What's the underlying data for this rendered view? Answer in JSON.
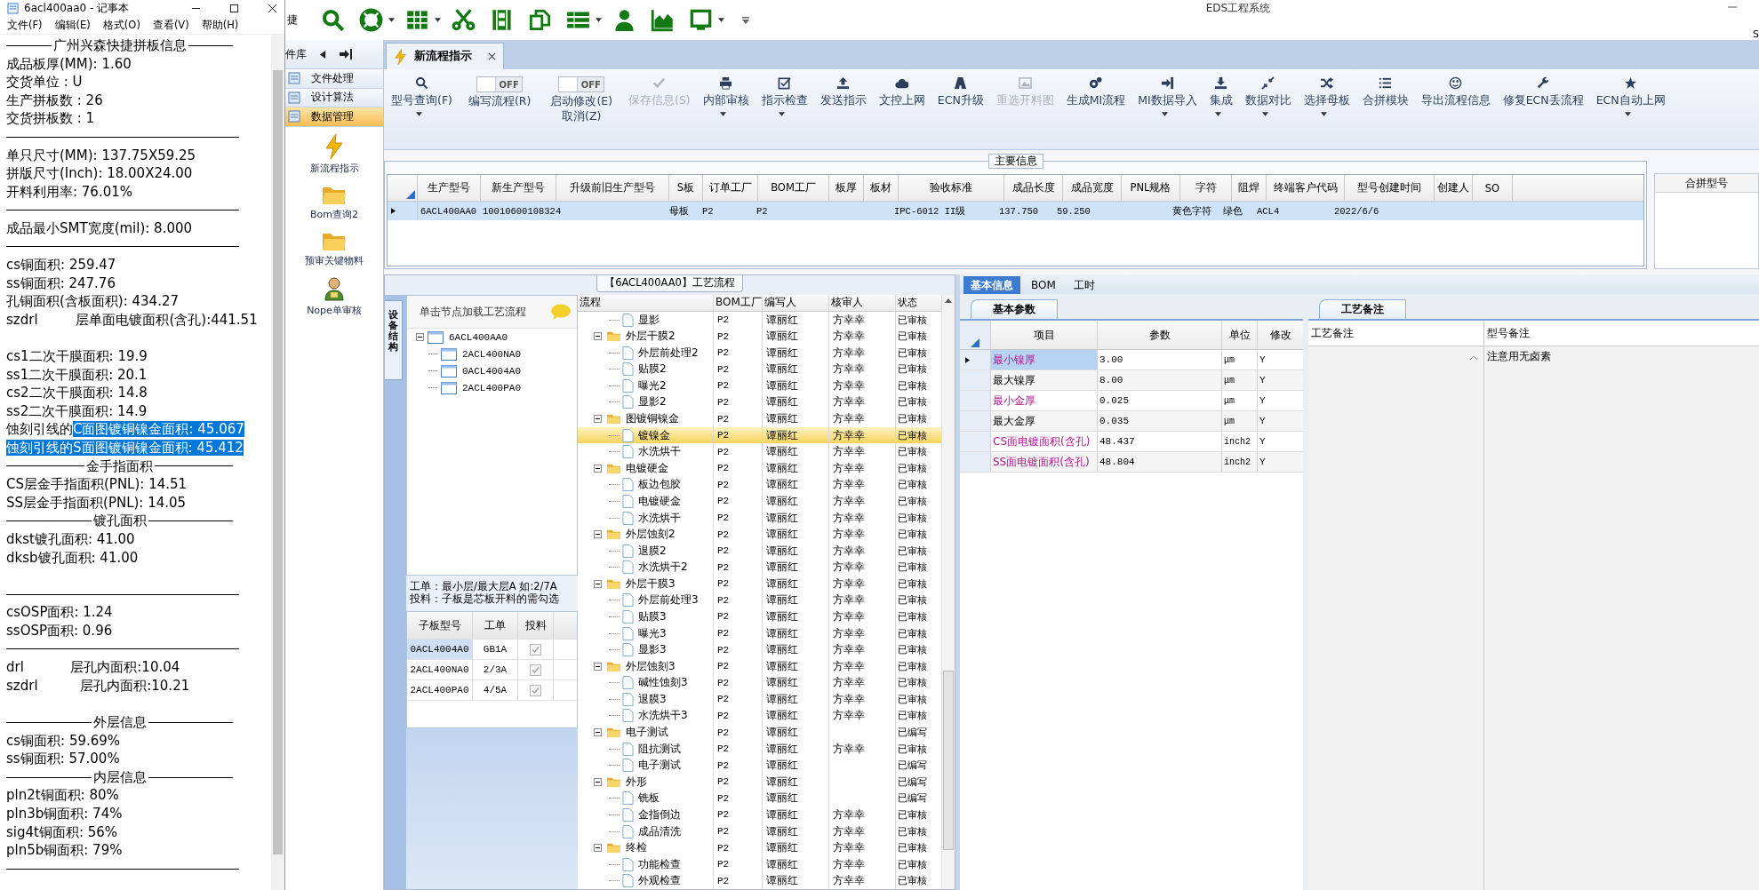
{
  "notepad": {
    "title": "6acl400aa0 - 记事本",
    "menu": [
      "文件(F)",
      "编辑(E)",
      "格式(O)",
      "查看(V)",
      "帮助(H)"
    ],
    "lines": [
      {
        "kind": "heading",
        "text": "广州兴森快捷拼板信息"
      },
      {
        "kind": "text",
        "text": "成品板厚(MM): 1.60"
      },
      {
        "kind": "text",
        "text": "交货单位 : U"
      },
      {
        "kind": "text",
        "text": "生产拼板数 : 26"
      },
      {
        "kind": "text",
        "text": "交货拼板数 : 1"
      },
      {
        "kind": "rule"
      },
      {
        "kind": "text",
        "text": "单只尺寸(MM): 137.75X59.25"
      },
      {
        "kind": "text",
        "text": "拼版尺寸(Inch): 18.00X24.00"
      },
      {
        "kind": "text",
        "text": "开料利用率: 76.01%"
      },
      {
        "kind": "rule"
      },
      {
        "kind": "text",
        "text": "成品最小SMT宽度(mil): 8.000"
      },
      {
        "kind": "rule"
      },
      {
        "kind": "text",
        "text": "cs铜面积: 259.47"
      },
      {
        "kind": "text",
        "text": "ss铜面积: 247.76"
      },
      {
        "kind": "text",
        "text": "孔铜面积(含板面积): 434.27"
      },
      {
        "kind": "text",
        "text": "szdrl         层单面电镀面积(含孔):441.51"
      },
      {
        "kind": "blank"
      },
      {
        "kind": "text",
        "text": "cs1二次干膜面积: 19.9"
      },
      {
        "kind": "text",
        "text": "ss1二次干膜面积: 20.1"
      },
      {
        "kind": "text",
        "text": "cs2二次干膜面积: 14.8"
      },
      {
        "kind": "text",
        "text": "ss2二次干膜面积: 14.9"
      },
      {
        "kind": "text",
        "text": "蚀刻引线的",
        "highlighted": "C面图镀铜镍金面积: 45.067"
      },
      {
        "kind": "text",
        "highlighted": "蚀刻引线的S面图镀铜镍金面积: 45.412"
      },
      {
        "kind": "heading",
        "text": "金手指面积"
      },
      {
        "kind": "text",
        "text": "CS层金手指面积(PNL): 14.51"
      },
      {
        "kind": "text",
        "text": "SS层金手指面积(PNL): 14.05"
      },
      {
        "kind": "heading",
        "text": "镀孔面积"
      },
      {
        "kind": "text",
        "text": "dkst镀孔面积: 41.00"
      },
      {
        "kind": "text",
        "text": "dksb镀孔面积: 41.00"
      },
      {
        "kind": "blank"
      },
      {
        "kind": "rule"
      },
      {
        "kind": "text",
        "text": "csOSP面积: 1.24"
      },
      {
        "kind": "text",
        "text": "ssOSP面积: 0.96"
      },
      {
        "kind": "rule"
      },
      {
        "kind": "text",
        "text": "drl           层孔内面积:10.04"
      },
      {
        "kind": "text",
        "text": "szdrl          层孔内面积:10.21"
      },
      {
        "kind": "blank"
      },
      {
        "kind": "heading",
        "text": "外层信息"
      },
      {
        "kind": "text",
        "text": "cs铜面积: 59.69%"
      },
      {
        "kind": "text",
        "text": "ss铜面积: 57.00%"
      },
      {
        "kind": "heading",
        "text": "内层信息"
      },
      {
        "kind": "text",
        "text": "pln2t铜面积: 80%"
      },
      {
        "kind": "text",
        "text": "pln3b铜面积: 74%"
      },
      {
        "kind": "text",
        "text": "sig4t铜面积: 56%"
      },
      {
        "kind": "text",
        "text": "pln5b铜面积: 79%"
      },
      {
        "kind": "rule"
      }
    ]
  },
  "app": {
    "title": "EDS工程系统",
    "quick_label": "捷",
    "edge_text": "S"
  },
  "components": {
    "title": "件库",
    "items": [
      {
        "label": "文件处理",
        "selected": false
      },
      {
        "label": "设计算法",
        "selected": false
      },
      {
        "label": "数据管理",
        "selected": true
      }
    ],
    "tools": [
      {
        "label": "新流程指示",
        "kind": "bolt"
      },
      {
        "label": "Bom查询2",
        "kind": "folder"
      },
      {
        "label": "预审关键物料",
        "kind": "folder"
      },
      {
        "label": "Nope单审核",
        "kind": "person"
      }
    ]
  },
  "doc_tab": {
    "label": "新流程指示",
    "selected": true
  },
  "ribbon": [
    {
      "kind": "button",
      "label": "型号查询(F)",
      "disabled": false,
      "dropdown": true
    },
    {
      "kind": "toggle",
      "label": "编写流程(R)",
      "switch_text": "OFF",
      "on": false
    },
    {
      "kind": "toggle",
      "label": "启动修改(E)",
      "label2": "取消(Z)",
      "switch_text": "OFF",
      "on": false
    },
    {
      "kind": "button",
      "label": "保存信息(S)",
      "disabled": true,
      "dropdown": false
    },
    {
      "kind": "button",
      "label": "内部审核",
      "disabled": false,
      "dropdown": true
    },
    {
      "kind": "button",
      "label": "指示检查",
      "disabled": false,
      "dropdown": true
    },
    {
      "kind": "button",
      "label": "发送指示",
      "disabled": false,
      "dropdown": false
    },
    {
      "kind": "button",
      "label": "文控上网",
      "disabled": false,
      "dropdown": false
    },
    {
      "kind": "button",
      "label": "ECN升级",
      "disabled": false,
      "dropdown": false
    },
    {
      "kind": "button",
      "label": "重选开料图",
      "disabled": true,
      "dropdown": false
    },
    {
      "kind": "button",
      "label": "生成MI流程",
      "disabled": false,
      "dropdown": false
    },
    {
      "kind": "button",
      "label": "MI数据导入",
      "disabled": false,
      "dropdown": true
    },
    {
      "kind": "button",
      "label": "集成",
      "disabled": false,
      "dropdown": true
    },
    {
      "kind": "button",
      "label": "数据对比",
      "disabled": false,
      "dropdown": true
    },
    {
      "kind": "button",
      "label": "选择母板",
      "disabled": false,
      "dropdown": true
    },
    {
      "kind": "button",
      "label": "合拼模块",
      "disabled": false,
      "dropdown": false
    },
    {
      "kind": "button",
      "label": "导出流程信息",
      "disabled": false,
      "dropdown": false
    },
    {
      "kind": "button",
      "label": "修复ECN丢流程",
      "disabled": false,
      "dropdown": false
    },
    {
      "kind": "button",
      "label": "ECN自动上网",
      "disabled": false,
      "dropdown": true
    }
  ],
  "main_info": {
    "title": "主要信息",
    "columns": [
      "生产型号",
      "新生产型号",
      "升级前旧生产型号",
      "S板",
      "订单工厂",
      "BOM工厂",
      "板厚",
      "板材",
      "验收标准",
      "成品长度",
      "成品宽度",
      "PNL规格",
      "字符",
      "阻焊",
      "终端客户代码",
      "型号创建时间",
      "创建人",
      "SO"
    ],
    "rows": [
      {
        "selected": true,
        "cells": [
          "6ACL400AA0",
          "10010600108324",
          null,
          "母板",
          "P2",
          "P2",
          null,
          null,
          "IPC-6012 II级",
          "137.750",
          "59.250",
          null,
          "黄色字符",
          "绿色",
          "ACL4",
          "2022/6/6",
          null,
          null
        ]
      }
    ],
    "side_column": "合拼型号"
  },
  "process": {
    "title": "【6ACL400AA0】工艺流程",
    "side_tab": "设备结构",
    "tree_hint": "单击节点加载工艺流程",
    "tree": [
      {
        "name": "6ACL400AA0",
        "expanded": true,
        "selected": false,
        "children": [
          {
            "name": "2ACL400NA0",
            "selected": false
          },
          {
            "name": "0ACL4004A0",
            "selected": false
          },
          {
            "name": "2ACL400PA0",
            "selected": false
          }
        ]
      }
    ],
    "notes": [
      "工单：最小层/最大层A 如:2/7A",
      "投料：子板是芯板开料的需勾选"
    ],
    "sub_grid": {
      "columns": [
        "子板型号",
        "工单",
        "投料"
      ],
      "rows": [
        {
          "cells": [
            "0ACL4004A0",
            "GB1A"
          ],
          "checked": true,
          "selected": true
        },
        {
          "cells": [
            "2ACL400NA0",
            "2/3A"
          ],
          "checked": true,
          "selected": false
        },
        {
          "cells": [
            "2ACL400PA0",
            "4/5A"
          ],
          "checked": true,
          "selected": false
        }
      ]
    },
    "flow": {
      "columns": [
        "流程",
        "BOM工厂",
        "编写人",
        "核审人",
        "状态"
      ],
      "nodes": [
        {
          "children": [
            {
              "name": "显影",
              "bom": "P2",
              "writer": "谭丽红",
              "reviewer": "方幸幸",
              "status": "已审核",
              "selected": false
            }
          ]
        },
        {
          "name": "外层干膜2",
          "bom": "P2",
          "writer": "谭丽红",
          "reviewer": "方幸幸",
          "status": "已审核",
          "selected": false,
          "expanded": true,
          "children": [
            {
              "name": "外层前处理2",
              "bom": "P2",
              "writer": "谭丽红",
              "reviewer": "方幸幸",
              "status": "已审核",
              "selected": false
            },
            {
              "name": "贴膜2",
              "bom": "P2",
              "writer": "谭丽红",
              "reviewer": "方幸幸",
              "status": "已审核",
              "selected": false
            },
            {
              "name": "曝光2",
              "bom": "P2",
              "writer": "谭丽红",
              "reviewer": "方幸幸",
              "status": "已审核",
              "selected": false
            },
            {
              "name": "显影2",
              "bom": "P2",
              "writer": "谭丽红",
              "reviewer": "方幸幸",
              "status": "已审核",
              "selected": false
            }
          ]
        },
        {
          "name": "图镀铜镍金",
          "bom": "P2",
          "writer": "谭丽红",
          "reviewer": "方幸幸",
          "status": "已审核",
          "selected": false,
          "expanded": true,
          "children": [
            {
              "name": "镀镍金",
              "bom": "P2",
              "writer": "谭丽红",
              "reviewer": "方幸幸",
              "status": "已审核",
              "selected": true
            },
            {
              "name": "水洗烘干",
              "bom": "P2",
              "writer": "谭丽红",
              "reviewer": "方幸幸",
              "status": "已审核",
              "selected": false
            }
          ]
        },
        {
          "name": "电镀硬金",
          "bom": "P2",
          "writer": "谭丽红",
          "reviewer": "方幸幸",
          "status": "已审核",
          "selected": false,
          "expanded": true,
          "children": [
            {
              "name": "板边包胶",
              "bom": "P2",
              "writer": "谭丽红",
              "reviewer": "方幸幸",
              "status": "已审核",
              "selected": false
            },
            {
              "name": "电镀硬金",
              "bom": "P2",
              "writer": "谭丽红",
              "reviewer": "方幸幸",
              "status": "已审核",
              "selected": false
            },
            {
              "name": "水洗烘干",
              "bom": "P2",
              "writer": "谭丽红",
              "reviewer": "方幸幸",
              "status": "已审核",
              "selected": false
            }
          ]
        },
        {
          "name": "外层蚀刻2",
          "bom": "P2",
          "writer": "谭丽红",
          "reviewer": "方幸幸",
          "status": "已审核",
          "selected": false,
          "expanded": true,
          "children": [
            {
              "name": "退膜2",
              "bom": "P2",
              "writer": "谭丽红",
              "reviewer": "方幸幸",
              "status": "已审核",
              "selected": false
            },
            {
              "name": "水洗烘干2",
              "bom": "P2",
              "writer": "谭丽红",
              "reviewer": "方幸幸",
              "status": "已审核",
              "selected": false
            }
          ]
        },
        {
          "name": "外层干膜3",
          "bom": "P2",
          "writer": "谭丽红",
          "reviewer": "方幸幸",
          "status": "已审核",
          "selected": false,
          "expanded": true,
          "children": [
            {
              "name": "外层前处理3",
              "bom": "P2",
              "writer": "谭丽红",
              "reviewer": "方幸幸",
              "status": "已审核",
              "selected": false
            },
            {
              "name": "贴膜3",
              "bom": "P2",
              "writer": "谭丽红",
              "reviewer": "方幸幸",
              "status": "已审核",
              "selected": false
            },
            {
              "name": "曝光3",
              "bom": "P2",
              "writer": "谭丽红",
              "reviewer": "方幸幸",
              "status": "已审核",
              "selected": false
            },
            {
              "name": "显影3",
              "bom": "P2",
              "writer": "谭丽红",
              "reviewer": "方幸幸",
              "status": "已审核",
              "selected": false
            }
          ]
        },
        {
          "name": "外层蚀刻3",
          "bom": "P2",
          "writer": "谭丽红",
          "reviewer": "方幸幸",
          "status": "已审核",
          "selected": false,
          "expanded": true,
          "children": [
            {
              "name": "碱性蚀刻3",
              "bom": "P2",
              "writer": "谭丽红",
              "reviewer": "方幸幸",
              "status": "已审核",
              "selected": false
            },
            {
              "name": "退膜3",
              "bom": "P2",
              "writer": "谭丽红",
              "reviewer": "方幸幸",
              "status": "已审核",
              "selected": false
            },
            {
              "name": "水洗烘干3",
              "bom": "P2",
              "writer": "谭丽红",
              "reviewer": "方幸幸",
              "status": "已审核",
              "selected": false
            }
          ]
        },
        {
          "name": "电子测试",
          "bom": "P2",
          "writer": "谭丽红",
          "status": "已编写",
          "selected": false,
          "expanded": true,
          "children": [
            {
              "name": "阻抗测试",
              "bom": "P2",
              "writer": "谭丽红",
              "reviewer": "方幸幸",
              "status": "已审核",
              "selected": false
            },
            {
              "name": "电子测试",
              "bom": "P2",
              "writer": "谭丽红",
              "status": "已编写",
              "selected": false
            }
          ]
        },
        {
          "name": "外形",
          "bom": "P2",
          "writer": "谭丽红",
          "status": "已编写",
          "selected": false,
          "expanded": true,
          "children": [
            {
              "name": "铣板",
              "bom": "P2",
              "writer": "谭丽红",
              "status": "已编写",
              "selected": false
            },
            {
              "name": "金指倒边",
              "bom": "P2",
              "writer": "谭丽红",
              "reviewer": "方幸幸",
              "status": "已审核",
              "selected": false
            },
            {
              "name": "成品清洗",
              "bom": "P2",
              "writer": "谭丽红",
              "reviewer": "方幸幸",
              "status": "已审核",
              "selected": false
            }
          ]
        },
        {
          "name": "终检",
          "bom": "P2",
          "writer": "谭丽红",
          "reviewer": "方幸幸",
          "status": "已审核",
          "selected": false,
          "expanded": true,
          "children": [
            {
              "name": "功能检查",
              "bom": "P2",
              "writer": "谭丽红",
              "reviewer": "方幸幸",
              "status": "已审核",
              "selected": false
            },
            {
              "name": "外观检查",
              "bom": "P2",
              "writer": "谭丽红",
              "reviewer": "方幸幸",
              "status": "已审核",
              "selected": false
            }
          ]
        }
      ]
    }
  },
  "detail": {
    "tabs": [
      {
        "label": "基本信息",
        "selected": true
      },
      {
        "label": "BOM",
        "selected": false
      },
      {
        "label": "工时",
        "selected": false
      }
    ],
    "params": {
      "tab": "基本参数",
      "columns": [
        "项目",
        "参数",
        "单位",
        "修改"
      ],
      "rows": [
        {
          "name": "最小镍厚",
          "value": "3.00",
          "unit": "μm",
          "modify": "Y",
          "emphasized": true,
          "selected": true
        },
        {
          "name": "最大镍厚",
          "value": "8.00",
          "unit": "μm",
          "modify": "Y",
          "emphasized": false,
          "selected": false
        },
        {
          "name": "最小金厚",
          "value": "0.025",
          "unit": "μm",
          "modify": "Y",
          "emphasized": true,
          "selected": false
        },
        {
          "name": "最大金厚",
          "value": "0.035",
          "unit": "μm",
          "modify": "Y",
          "emphasized": false,
          "selected": false
        },
        {
          "name": "CS面电镀面积(含孔)",
          "value": "48.437",
          "unit": "inch2",
          "modify": "Y",
          "emphasized": true,
          "selected": false
        },
        {
          "name": "SS面电镀面积(含孔)",
          "value": "48.804",
          "unit": "inch2",
          "modify": "Y",
          "emphasized": true,
          "selected": false
        }
      ]
    },
    "remarks": {
      "tab": "工艺备注",
      "columns": [
        "工艺备注",
        "型号备注"
      ],
      "model_remark": "注意用无卤素"
    }
  }
}
